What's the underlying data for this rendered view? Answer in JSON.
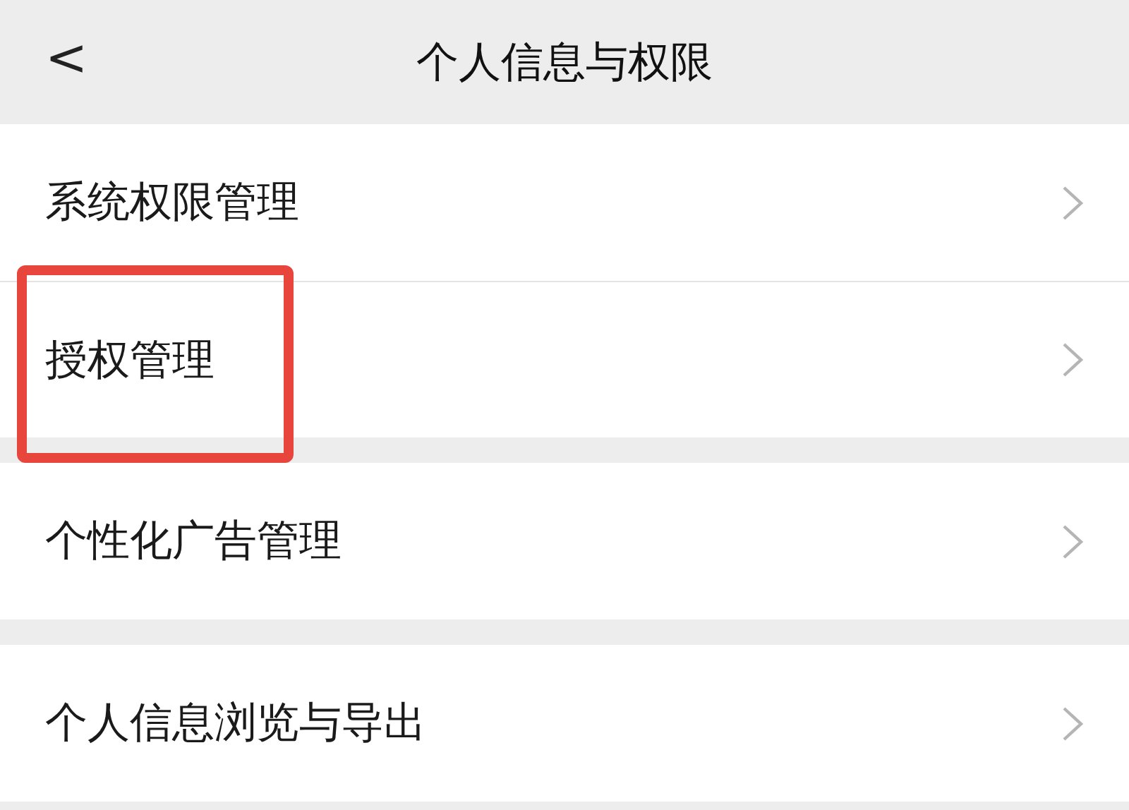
{
  "header": {
    "back": "<",
    "title": "个人信息与权限"
  },
  "groups": [
    {
      "items": [
        {
          "label": "系统权限管理",
          "highlighted": false
        },
        {
          "label": "授权管理",
          "highlighted": true
        }
      ]
    },
    {
      "items": [
        {
          "label": "个性化广告管理",
          "highlighted": false
        }
      ]
    },
    {
      "items": [
        {
          "label": "个人信息浏览与导出",
          "highlighted": false
        }
      ]
    }
  ]
}
